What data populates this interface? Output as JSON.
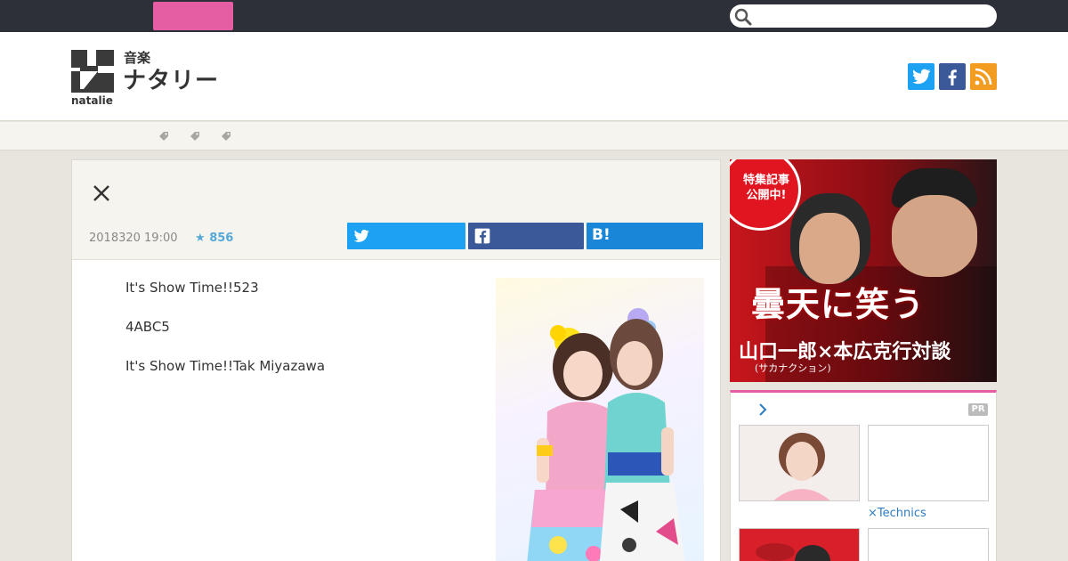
{
  "site": {
    "logo_category": "音楽",
    "logo_name": "ナタリー",
    "logo_word": "natalie"
  },
  "search": {
    "placeholder": "",
    "value": ""
  },
  "social": [
    "twitter-icon",
    "facebook-icon",
    "rss-icon"
  ],
  "tags": [
    "tag-icon",
    "tag-icon",
    "tag-icon"
  ],
  "article": {
    "date": "2018320 19:00",
    "star_count": "856",
    "share_hatena_label": "B!",
    "lead_lines": [
      "It's Show Time!!523",
      "4ABC5",
      "It's Show Time!!Tak Miyazawa"
    ]
  },
  "banner": {
    "badge_line1": "特集記事",
    "badge_line2": "公開中!",
    "title": "曇天に笑う",
    "subtitle": "山口一郎×本広克行対談",
    "subtitle_note": "(サカナクション)"
  },
  "pr": {
    "badge": "PR",
    "caption": "×Technics"
  },
  "colors": {
    "topbar": "#2e3039",
    "accent_pink": "#e55ea4",
    "twitter": "#1da1f2",
    "facebook": "#3b5998",
    "hatena": "#1a86d8",
    "rss": "#f39c22",
    "link": "#2c7bc0"
  }
}
